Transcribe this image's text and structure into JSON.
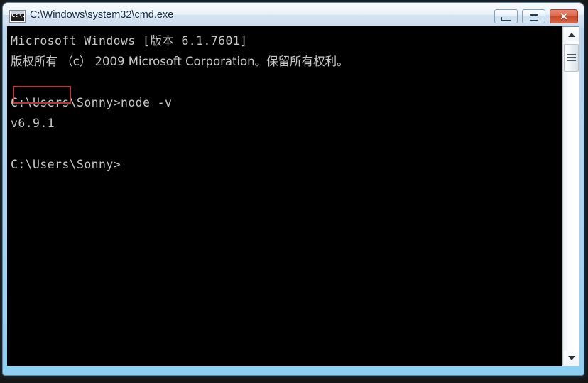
{
  "window": {
    "title": "C:\\Windows\\system32\\cmd.exe",
    "icon": "cmd-console-icon",
    "frame_color": "#8ed0f2",
    "titlebar_text_color": "#0d2a4a"
  },
  "caption_buttons": {
    "minimize_label": "Minimize",
    "maximize_label": "Maximize",
    "close_label": "✕",
    "close_color": "#c9482a"
  },
  "console": {
    "background": "#000000",
    "foreground": "#c8c8c8",
    "lines": [
      "Microsoft Windows [版本 6.1.7601]",
      "版权所有 （c） 2009 Microsoft Corporation。保留所有权利。",
      "",
      "C:\\Users\\Sonny>node -v",
      "v6.9.1",
      "",
      "C:\\Users\\Sonny>"
    ],
    "version_output": "v6.9.1",
    "prompt": "C:\\Users\\Sonny>",
    "command": "node -v",
    "highlight": {
      "target": "v6.9.1",
      "border_color": "#b03a3a"
    }
  },
  "scrollbar": {
    "up_arrow": "▲",
    "down_arrow": "▼",
    "thumb_position": "near-top"
  }
}
